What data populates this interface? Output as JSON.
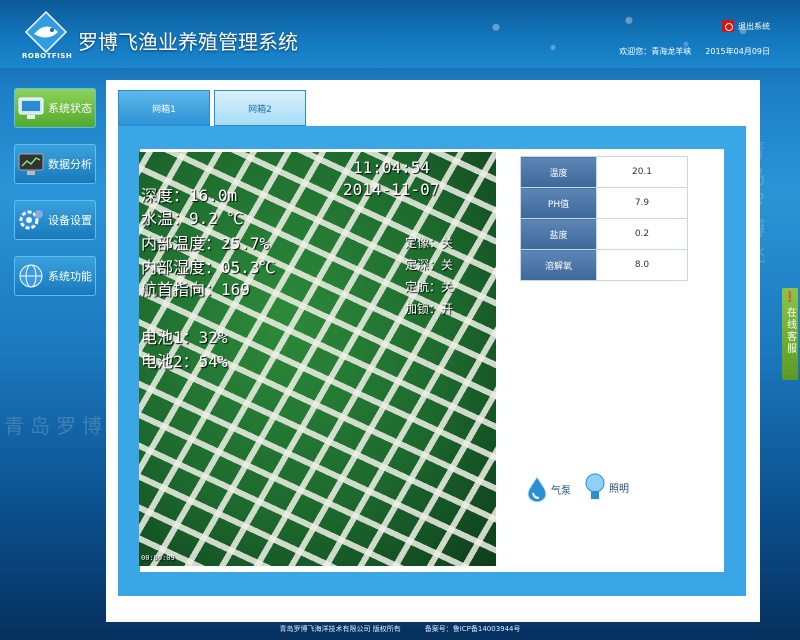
{
  "header": {
    "app_title": "罗博飞渔业养殖管理系统",
    "logo_text": "ROBOTFISH",
    "logout_label": "退出系统",
    "welcome": "欢迎您：青海龙羊峡",
    "date": "2015年04月09日"
  },
  "sidebar": {
    "items": [
      {
        "label": "系统状态",
        "icon": "monitor-icon",
        "active": true
      },
      {
        "label": "数据分析",
        "icon": "chart-monitor-icon",
        "active": false
      },
      {
        "label": "设备设置",
        "icon": "gear-icon",
        "active": false
      },
      {
        "label": "系统功能",
        "icon": "globe-icon",
        "active": false
      }
    ]
  },
  "tabs": [
    {
      "label": "网箱1",
      "active": true
    },
    {
      "label": "网箱2",
      "active": false
    }
  ],
  "video": {
    "time": "11:04:54",
    "date": "2014-11-07",
    "depth": "深度：16.0m",
    "water_temp": "水温：9.2 ℃",
    "inner_temp": "内部温度：25.7%",
    "inner_humidity": "内部湿度：05.3℃",
    "heading": "航首指向：169",
    "battery1": "电池1：32%",
    "battery2": "电池2：54%",
    "fix_heading": "定像：关",
    "fix_depth": "定深：关",
    "fix_course": "定航：关",
    "lock": "加锁：开",
    "elapsed": "00:00:09"
  },
  "readings": [
    {
      "name": "温度",
      "value": "20.1"
    },
    {
      "name": "PH值",
      "value": "7.9"
    },
    {
      "name": "盐度",
      "value": "0.2"
    },
    {
      "name": "溶解氧",
      "value": "8.0"
    }
  ],
  "controls": {
    "pump_label": "气泵",
    "light_label": "照明"
  },
  "service": {
    "label": "在线客服"
  },
  "footer": {
    "company": "青岛罗博飞海洋技术有限公司  版权所有",
    "icp": "备案号：鲁ICP备14003944号"
  },
  "watermark": "青岛罗博飞",
  "colors": {
    "accent": "#3aa6e6",
    "active_nav": "#6cc23e",
    "table_header": "#4a74a6"
  }
}
